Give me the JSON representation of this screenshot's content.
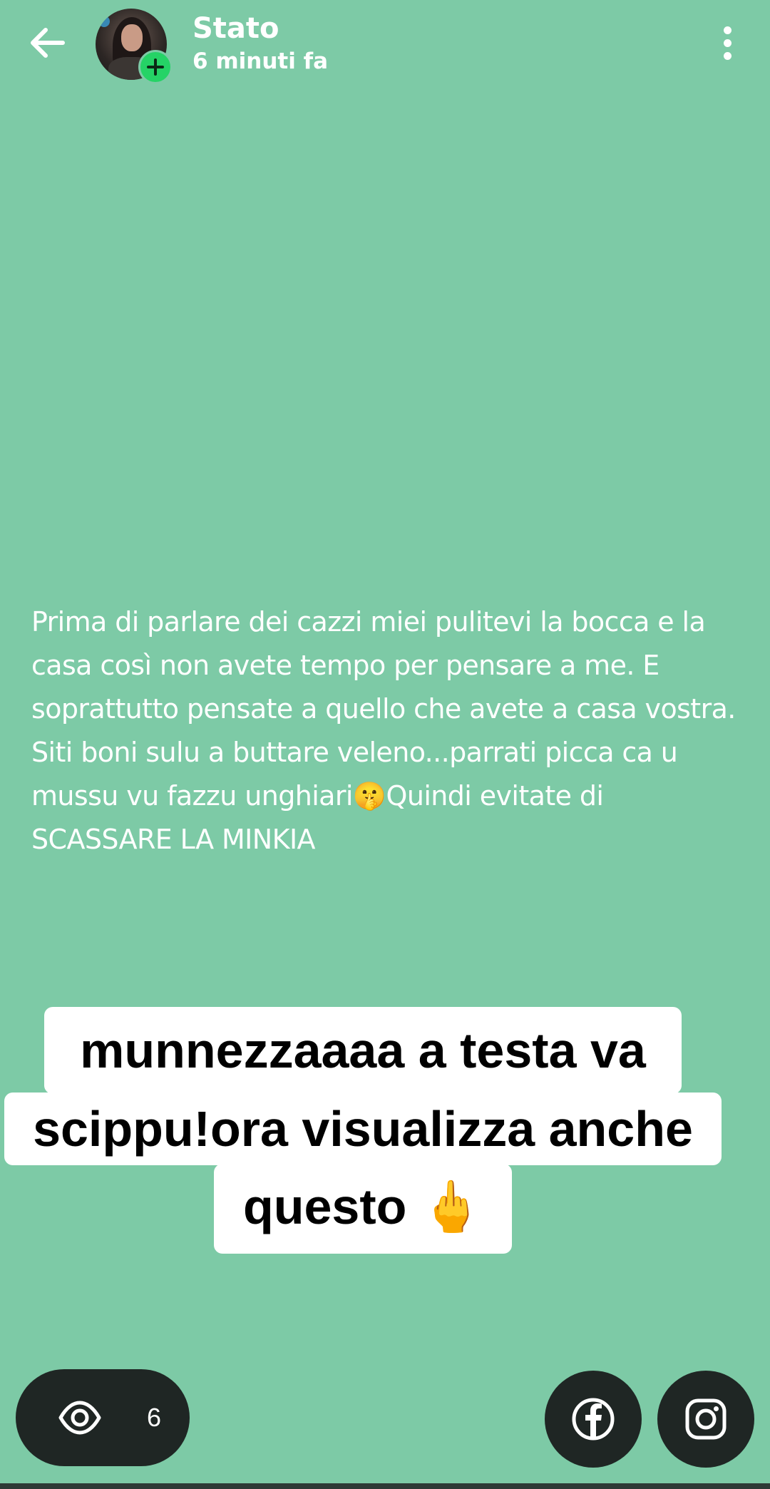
{
  "header": {
    "title": "Stato",
    "timestamp": "6 minuti fa",
    "back_icon": "arrow-left-icon",
    "menu_icon": "more-vertical-icon"
  },
  "status": {
    "text": "Prima di parlare dei cazzi miei pulitevi la bocca e la casa così non avete tempo per pensare a me. E soprattutto pensate a quello che avete a casa vostra. Siti boni sulu a buttare veleno...parrati picca ca u mussu vu fazzu unghiari🤫Quindi evitate di SCASSARE LA MINKIA",
    "background_color": "#7dcaa6"
  },
  "caption": {
    "line1": "munnezzaaaa a testa va",
    "line2": "scippu!ora visualizza anche",
    "line3": "questo 🖕"
  },
  "footer": {
    "views_icon": "eye-icon",
    "views_count": "6",
    "facebook_icon": "facebook-icon",
    "instagram_icon": "instagram-icon"
  }
}
